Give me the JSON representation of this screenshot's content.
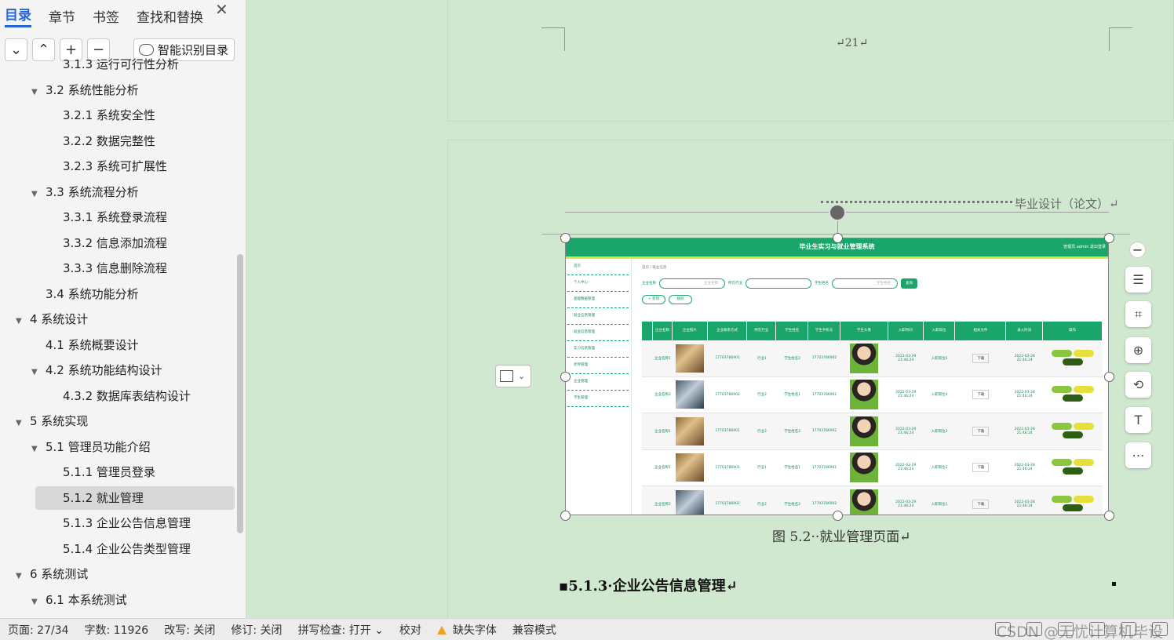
{
  "nav": {
    "tabs": [
      "目录",
      "章节",
      "书签",
      "查找和替换"
    ],
    "close": "✕",
    "smart_toc": "智能识别目录",
    "items": [
      {
        "label": "3.1.3  运行可行性分析",
        "level": 3,
        "arrow": ""
      },
      {
        "label": "3.2 系统性能分析",
        "level": 2,
        "arrow": "▼"
      },
      {
        "label": "3.2.1  系统安全性",
        "level": 3,
        "arrow": ""
      },
      {
        "label": "3.2.2  数据完整性",
        "level": 3,
        "arrow": ""
      },
      {
        "label": "3.2.3 系统可扩展性",
        "level": 3,
        "arrow": ""
      },
      {
        "label": "3.3 系统流程分析",
        "level": 2,
        "arrow": "▼"
      },
      {
        "label": "3.3.1 系统登录流程",
        "level": 3,
        "arrow": ""
      },
      {
        "label": "3.3.2 信息添加流程",
        "level": 3,
        "arrow": ""
      },
      {
        "label": "3.3.3 信息删除流程",
        "level": 3,
        "arrow": ""
      },
      {
        "label": "3.4 系统功能分析",
        "level": 2,
        "arrow": ""
      },
      {
        "label": "4  系统设计",
        "level": 1,
        "arrow": "▼"
      },
      {
        "label": "4.1 系统概要设计",
        "level": 2,
        "arrow": ""
      },
      {
        "label": "4.2 系统功能结构设计",
        "level": 2,
        "arrow": "▼"
      },
      {
        "label": "4.3.2  数据库表结构设计",
        "level": 3,
        "arrow": ""
      },
      {
        "label": "5  系统实现",
        "level": 1,
        "arrow": "▼"
      },
      {
        "label": "5.1 管理员功能介绍",
        "level": 2,
        "arrow": "▼"
      },
      {
        "label": "5.1.1 管理员登录",
        "level": 3,
        "arrow": ""
      },
      {
        "label": "5.1.2  就业管理",
        "level": 3,
        "arrow": "",
        "selected": true
      },
      {
        "label": "5.1.3  企业公告信息管理",
        "level": 3,
        "arrow": ""
      },
      {
        "label": "5.1.4 企业公告类型管理",
        "level": 3,
        "arrow": ""
      },
      {
        "label": "6 系统测试",
        "level": 1,
        "arrow": "▼"
      },
      {
        "label": "6.1  本系统测试",
        "level": 2,
        "arrow": "▼"
      }
    ]
  },
  "status": {
    "page": "页面: 27/34",
    "words": "字数: 11926",
    "overwrite": "改写: 关闭",
    "revise": "修订: 关闭",
    "spell": "拼写检查: 打开 ⌄",
    "proof": "校对",
    "missing_font": "缺失字体",
    "compat": "兼容模式",
    "watermark": "CSDN @无忧计算机毕设"
  },
  "doc": {
    "page_number": "↵21↵",
    "header": "毕业设计（论文）↵",
    "caption": "图 5.2··就业管理页面↵",
    "heading": "▪5.1.3·企业公告信息管理↵"
  },
  "shot": {
    "title": "毕业生实习与就业管理系统",
    "header_right": "管理员 admin    退出登录",
    "menu": [
      "首页",
      "个人中心",
      "基础数据管理",
      "就业信息管理",
      "就业信息管理",
      "实习信息管理",
      "老师管理",
      "企业管理",
      "学生管理"
    ],
    "crumb": "首页  /  就业信息",
    "filters": {
      "company": "企业名称",
      "industry": "所在行业",
      "student": "学生姓名",
      "search": "查询"
    },
    "ops": [
      "+ 新增",
      "删除"
    ],
    "headers": [
      "企业名称",
      "企业照片",
      "企业联系方式",
      "所在行业",
      "学生姓名",
      "学生手机号",
      "学生头像",
      "入职时间",
      "入职岗位",
      "相关文件",
      "录入时间",
      "操作"
    ],
    "rows": [
      {
        "company": "企业名称1",
        "pic": "a",
        "phone": "17703786901",
        "industry": "行业1",
        "student": "学生姓名2",
        "sphone": "17703786902",
        "time": "2022-03-29 21:46:24",
        "post": "入职岗位5",
        "file": "下载",
        "created": "2022-03-28 21:46:24"
      },
      {
        "company": "企业名称2",
        "pic": "b",
        "phone": "17703786902",
        "industry": "行业2",
        "student": "学生姓名1",
        "sphone": "17703786901",
        "time": "2022-03-29 21:46:24",
        "post": "入职岗位4",
        "file": "下载",
        "created": "2022-03-28 21:46:24"
      },
      {
        "company": "企业名称1",
        "pic": "a",
        "phone": "17703786901",
        "industry": "行业2",
        "student": "学生姓名2",
        "sphone": "17703786902",
        "time": "2022-03-29 21:46:24",
        "post": "入职岗位3",
        "file": "下载",
        "created": "2022-03-28 21:46:24"
      },
      {
        "company": "企业名称1",
        "pic": "a",
        "phone": "17703786901",
        "industry": "行业1",
        "student": "学生姓名1",
        "sphone": "17703786901",
        "time": "2022-03-29 21:46:24",
        "post": "入职岗位2",
        "file": "下载",
        "created": "2022-03-28 21:46:24"
      },
      {
        "company": "企业名称2",
        "pic": "b",
        "phone": "17703786902",
        "industry": "行业2",
        "student": "学生姓名2",
        "sphone": "17703786902",
        "time": "2022-03-29 21:46:24",
        "post": "入职岗位1",
        "file": "下载",
        "created": "2022-03-28 21:46:24"
      }
    ],
    "actions": [
      "详情",
      "修改",
      "删除"
    ],
    "action_colors": [
      "#8cc63f",
      "#e8e03a",
      "#2e5e14"
    ]
  },
  "icons": {
    "tool_buttons": [
      "chevron-down-icon",
      "chevron-up-icon",
      "plus-icon",
      "minus-icon"
    ],
    "right_tools": [
      "minus-icon",
      "text-wrap-icon",
      "crop-icon",
      "zoom-in-icon",
      "rotate-icon",
      "ocr-text-icon",
      "more-icon"
    ]
  }
}
